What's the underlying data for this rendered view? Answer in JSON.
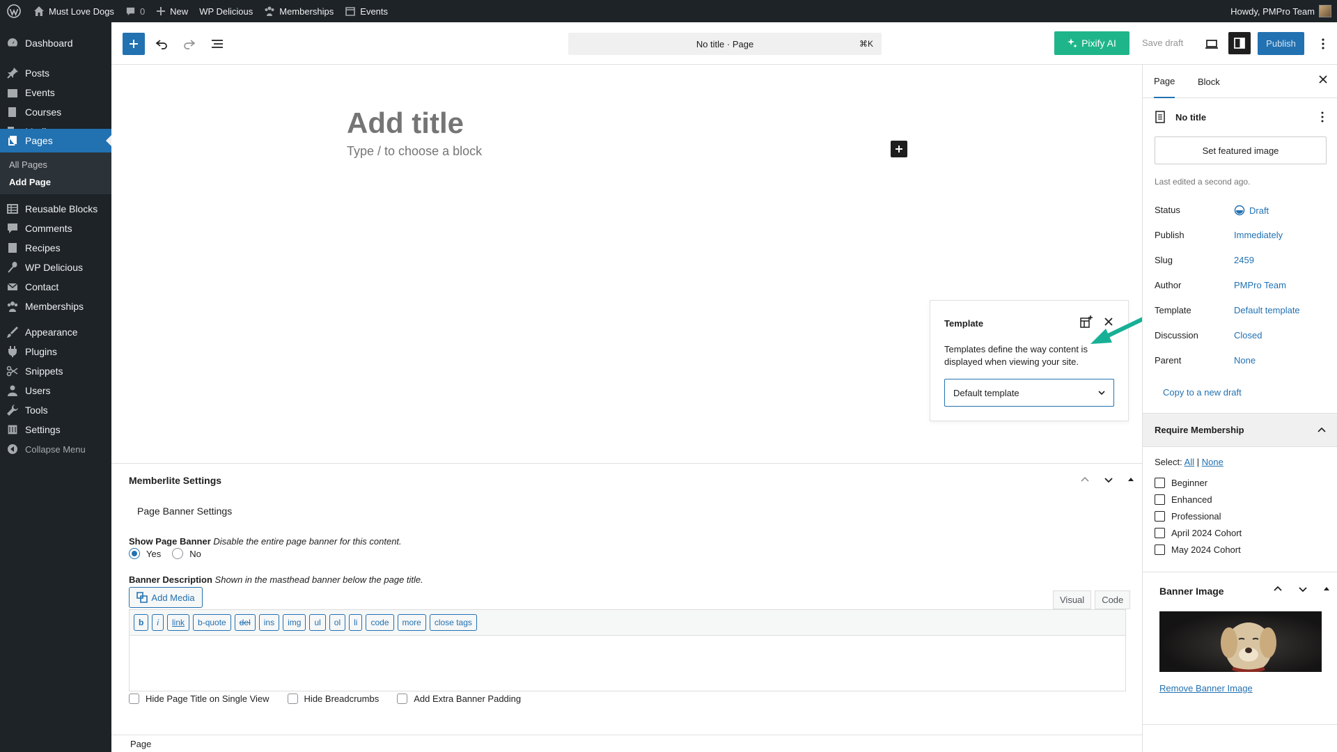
{
  "adminbar": {
    "site_name": "Must Love Dogs",
    "comments_count": "0",
    "new_label": "New",
    "wp_delicious": "WP Delicious",
    "memberships": "Memberships",
    "events": "Events",
    "howdy": "Howdy, PMPro Team"
  },
  "menu": {
    "items": [
      {
        "label": "Dashboard",
        "icon": "dashboard-icon"
      },
      {
        "label": "Posts",
        "icon": "pin-icon"
      },
      {
        "label": "Events",
        "icon": "calendar-icon"
      },
      {
        "label": "Courses",
        "icon": "book-icon"
      },
      {
        "label": "Media",
        "icon": "media-icon"
      },
      {
        "label": "Pages",
        "icon": "pages-icon"
      },
      {
        "label": "Reusable Blocks",
        "icon": "table-icon"
      },
      {
        "label": "Comments",
        "icon": "comment-icon"
      },
      {
        "label": "Recipes",
        "icon": "recipe-icon"
      },
      {
        "label": "WP Delicious",
        "icon": "spoon-icon"
      },
      {
        "label": "Contact",
        "icon": "mail-icon"
      },
      {
        "label": "Memberships",
        "icon": "members-icon"
      },
      {
        "label": "Appearance",
        "icon": "brush-icon"
      },
      {
        "label": "Plugins",
        "icon": "plug-icon"
      },
      {
        "label": "Snippets",
        "icon": "scissors-icon"
      },
      {
        "label": "Users",
        "icon": "user-icon"
      },
      {
        "label": "Tools",
        "icon": "wrench-icon"
      },
      {
        "label": "Settings",
        "icon": "settings-icon"
      }
    ],
    "sub": {
      "all_pages": "All Pages",
      "add_page": "Add Page"
    },
    "collapse": "Collapse Menu"
  },
  "header": {
    "command_bar": "No title · Page",
    "shortcut": "⌘K",
    "pixify": "Pixify AI",
    "save_draft": "Save draft",
    "publish": "Publish"
  },
  "canvas": {
    "title_placeholder": "Add title",
    "block_hint": "Type / to choose a block"
  },
  "template_popover": {
    "title": "Template",
    "description": "Templates define the way content is displayed when viewing your site.",
    "selected": "Default template"
  },
  "metabox": {
    "title": "Memberlite Settings",
    "subheading": "Page Banner Settings",
    "show_banner_label": "Show Page Banner",
    "show_banner_desc": "Disable the entire page banner for this content.",
    "yes": "Yes",
    "no": "No",
    "banner_desc_label": "Banner Description",
    "banner_desc_help": "Shown in the masthead banner below the page title.",
    "add_media": "Add Media",
    "tab_visual": "Visual",
    "tab_code": "Code",
    "quicktags": [
      "b",
      "i",
      "link",
      "b-quote",
      "del",
      "ins",
      "img",
      "ul",
      "ol",
      "li",
      "code",
      "more",
      "close tags"
    ],
    "checkboxes": [
      "Hide Page Title on Single View",
      "Hide Breadcrumbs",
      "Add Extra Banner Padding"
    ]
  },
  "footer": {
    "breadcrumb": "Page"
  },
  "sidebar": {
    "tab_page": "Page",
    "tab_block": "Block",
    "doc_title": "No title",
    "featured_image_btn": "Set featured image",
    "last_edited": "Last edited a second ago.",
    "rows": [
      {
        "label": "Status",
        "value": "Draft"
      },
      {
        "label": "Publish",
        "value": "Immediately"
      },
      {
        "label": "Slug",
        "value": "2459"
      },
      {
        "label": "Author",
        "value": "PMPro Team"
      },
      {
        "label": "Template",
        "value": "Default template"
      },
      {
        "label": "Discussion",
        "value": "Closed"
      },
      {
        "label": "Parent",
        "value": "None"
      }
    ],
    "copy_draft": "Copy to a new draft",
    "require_membership": "Require Membership",
    "select_label": "Select:",
    "select_all": "All",
    "select_sep": "|",
    "select_none": "None",
    "levels": [
      "Beginner",
      "Enhanced",
      "Professional",
      "April 2024 Cohort",
      "May 2024 Cohort"
    ],
    "banner_image_title": "Banner Image",
    "remove_banner": "Remove Banner Image"
  },
  "colors": {
    "admin_dark": "#1d2327",
    "wp_blue": "#2271b1",
    "pixify_green": "#1fb58a",
    "annotation_arrow": "#17b096"
  }
}
